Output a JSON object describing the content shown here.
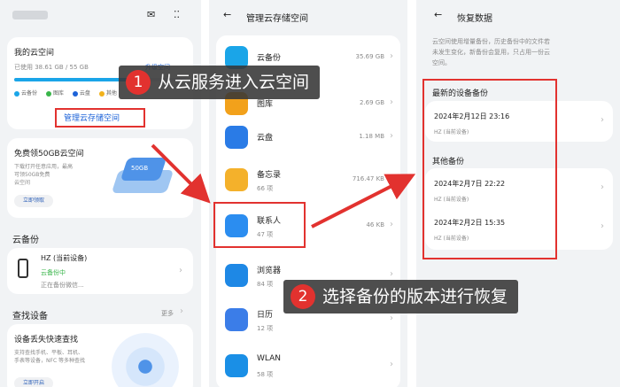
{
  "panel1": {
    "cloud_space": {
      "title": "我的云空间",
      "used": "已使用 38.61 GB / 55 GB",
      "upgrade_link": "升级空间",
      "legend": [
        {
          "label": "云备份",
          "color": "#1aa5e8"
        },
        {
          "label": "图库",
          "color": "#39b54a"
        },
        {
          "label": "云盘",
          "color": "#1d63d8"
        },
        {
          "label": "其他",
          "color": "#f2b21b"
        }
      ],
      "manage_link": "管理云存储空间",
      "usage_fraction": 0.7
    },
    "promo": {
      "title": "免费领50GB云空间",
      "desc1": "下载打开任意应用，最高",
      "desc2": "可领50GB免费",
      "desc3": "云空间",
      "button": "立即领取",
      "graphic_text": "50GB"
    },
    "backup_section": {
      "header": "云备份",
      "device": "HZ (当前设备)",
      "status": "云备份中",
      "detail": "正在备份微信..."
    },
    "find_section": {
      "header": "查找设备",
      "more": "更多",
      "title": "设备丢失快速查找",
      "desc1": "支持查找手机、平板、耳机、",
      "desc2": "手表等设备，NFC 等多种查找",
      "button": "立即开启"
    }
  },
  "panel2": {
    "title": "管理云存储空间",
    "items": [
      {
        "name": "云备份",
        "sub": "",
        "size": "35.69 GB",
        "color": "#1aa5e8",
        "icon": "cloud-backup-icon"
      },
      {
        "name": "图库",
        "sub": "",
        "size": "2.69 GB",
        "color": "#f2a11b",
        "icon": "gallery-icon"
      },
      {
        "name": "云盘",
        "sub": "",
        "size": "1.18 MB",
        "color": "#2a7be6",
        "icon": "cloud-drive-icon"
      },
      {
        "name": "备忘录",
        "sub": "66 项",
        "size": "716.47 KB",
        "color": "#f4b12b",
        "icon": "notes-icon"
      },
      {
        "name": "联系人",
        "sub": "47 项",
        "size": "46 KB",
        "color": "#2b8df0",
        "icon": "contacts-icon"
      },
      {
        "name": "浏览器",
        "sub": "84 项",
        "size": "",
        "color": "#1e88e5",
        "icon": "browser-icon"
      },
      {
        "name": "日历",
        "sub": "12 项",
        "size": "",
        "color": "#3b7de8",
        "icon": "calendar-icon"
      },
      {
        "name": "WLAN",
        "sub": "58 项",
        "size": "",
        "color": "#1a8fe6",
        "icon": "wlan-icon"
      }
    ]
  },
  "panel3": {
    "title": "恢复数据",
    "desc1": "云空间使用增量备份，历史备份中的文件若",
    "desc2": "未发生变化，新备份会复用，只占用一份云",
    "desc3": "空间。",
    "latest_header": "最新的设备备份",
    "latest": {
      "date": "2024年2月12日  23:16",
      "device": "HZ (当前设备)"
    },
    "others_header": "其他备份",
    "others": [
      {
        "date": "2024年2月7日  22:22",
        "device": "HZ (当前设备)"
      },
      {
        "date": "2024年2月2日  15:35",
        "device": "HZ (当前设备)"
      }
    ]
  },
  "callouts": {
    "step1_num": "1",
    "step1_text": "从云服务进入云空间",
    "step2_num": "2",
    "step2_text": "选择备份的版本进行恢复"
  },
  "colors": {
    "accent_red": "#e2322f",
    "link_blue": "#1d63d8",
    "panel_bg": "#f1f3f5"
  }
}
